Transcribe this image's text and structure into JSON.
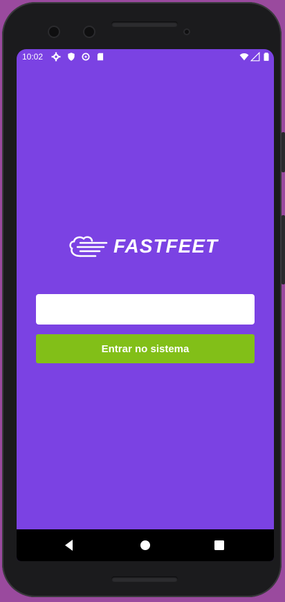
{
  "status_bar": {
    "time": "10:02",
    "left_icons": [
      "settings-icon",
      "shield-icon",
      "data-saver-icon",
      "sd-card-icon"
    ],
    "right_icons": [
      "wifi-icon",
      "cellular-signal-icon",
      "battery-icon"
    ]
  },
  "brand": {
    "name": "FASTFEET",
    "logo_icon": "fast-cloud-icon"
  },
  "login": {
    "input_value": "",
    "input_placeholder": "",
    "button_label": "Entrar no sistema"
  },
  "nav": {
    "icons": [
      "back-icon",
      "home-icon",
      "recents-icon"
    ]
  },
  "colors": {
    "background": "#7b42e3",
    "button": "#82bf18",
    "input": "#ffffff",
    "text": "#ffffff"
  }
}
